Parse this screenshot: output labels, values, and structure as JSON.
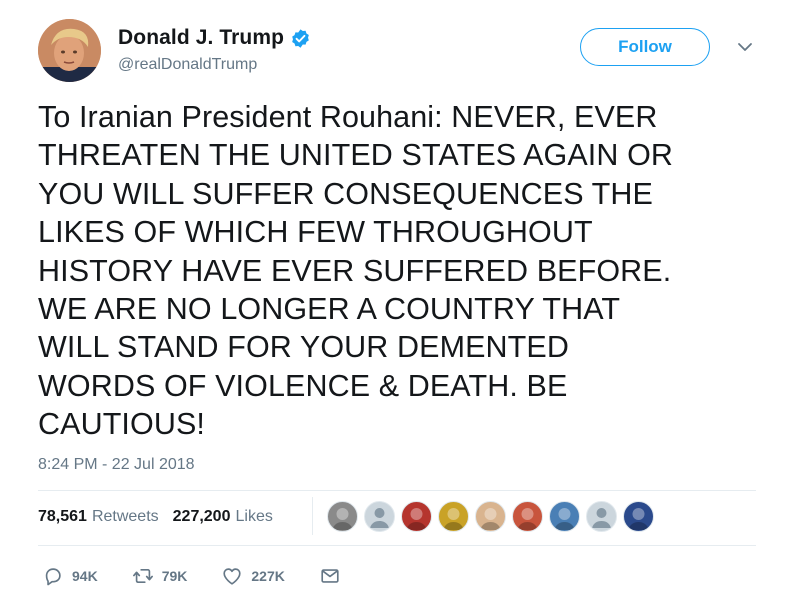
{
  "author": {
    "display_name": "Donald J. Trump",
    "handle": "@realDonaldTrump",
    "verified": true
  },
  "header": {
    "follow_label": "Follow",
    "menu_icon": "chevron-down-icon"
  },
  "tweet": {
    "text": "To Iranian President Rouhani: NEVER, EVER\nTHREATEN THE UNITED STATES AGAIN OR\nYOU WILL SUFFER CONSEQUENCES THE\nLIKES OF WHICH FEW THROUGHOUT\nHISTORY HAVE EVER SUFFERED BEFORE.\nWE ARE NO LONGER A COUNTRY THAT\nWILL STAND FOR YOUR DEMENTED\nWORDS OF VIOLENCE & DEATH. BE\nCAUTIOUS!",
    "timestamp": "8:24 PM - 22 Jul 2018"
  },
  "stats": {
    "retweets_count": "78,561",
    "retweets_label": "Retweets",
    "likes_count": "227,200",
    "likes_label": "Likes"
  },
  "likers": [
    {
      "name": "liker-avatar-1",
      "color": "#8a8a8a"
    },
    {
      "name": "liker-avatar-2",
      "color": "#ccd6dd"
    },
    {
      "name": "liker-avatar-3",
      "color": "#b5352e"
    },
    {
      "name": "liker-avatar-4",
      "color": "#c9a227"
    },
    {
      "name": "liker-avatar-5",
      "color": "#d9b48f"
    },
    {
      "name": "liker-avatar-6",
      "color": "#c8553d"
    },
    {
      "name": "liker-avatar-7",
      "color": "#4a7fb5"
    },
    {
      "name": "liker-avatar-8",
      "color": "#ccd6dd"
    },
    {
      "name": "liker-avatar-9",
      "color": "#2b4a8c"
    }
  ],
  "actions": {
    "reply_count": "94K",
    "retweet_count": "79K",
    "like_count": "227K"
  },
  "colors": {
    "accent": "#1da1f2",
    "text": "#14171a",
    "muted": "#657786",
    "divider": "#e6ecf0"
  }
}
